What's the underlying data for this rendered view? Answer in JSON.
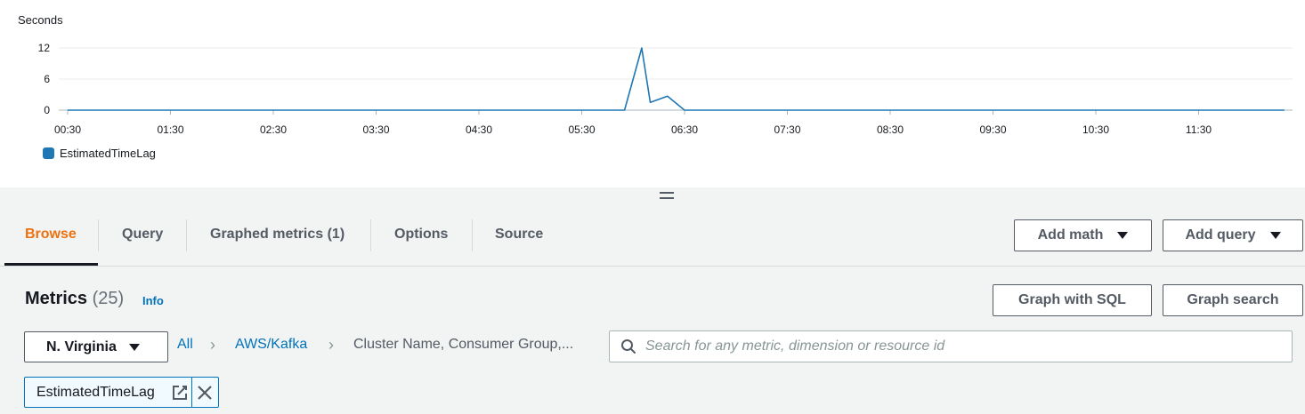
{
  "chart_data": {
    "type": "line",
    "ylabel": "Seconds",
    "y_ticks": [
      "12",
      "6",
      "0"
    ],
    "x_ticks": [
      "00:30",
      "01:30",
      "02:30",
      "03:30",
      "04:30",
      "05:30",
      "06:30",
      "07:30",
      "08:30",
      "09:30",
      "10:30",
      "11:30"
    ],
    "ylim": [
      0,
      12
    ],
    "grid": true,
    "legend_position": "bottom-left",
    "series": [
      {
        "name": "EstimatedTimeLag",
        "color": "#1f77b4",
        "points": [
          {
            "x": "00:30",
            "y": 0
          },
          {
            "x": "05:55",
            "y": 0
          },
          {
            "x": "06:05",
            "y": 12
          },
          {
            "x": "06:10",
            "y": 1.5
          },
          {
            "x": "06:20",
            "y": 2.7
          },
          {
            "x": "06:30",
            "y": 0
          },
          {
            "x": "11:30",
            "y": 0
          },
          {
            "x": "12:20",
            "y": 0
          }
        ]
      }
    ]
  },
  "tabs": [
    {
      "label": "Browse",
      "active": true
    },
    {
      "label": "Query"
    },
    {
      "label": "Graphed metrics (1)"
    },
    {
      "label": "Options"
    },
    {
      "label": "Source"
    }
  ],
  "toolbar": {
    "add_math": "Add math",
    "add_query": "Add query",
    "graph_with_sql": "Graph with SQL",
    "graph_search": "Graph search"
  },
  "metrics": {
    "title": "Metrics",
    "count": "(25)",
    "info": "Info"
  },
  "region": "N. Virginia",
  "breadcrumb": [
    "All",
    "AWS/Kafka",
    "Cluster Name, Consumer Group,..."
  ],
  "search": {
    "placeholder": "Search for any metric, dimension or resource id",
    "value": ""
  },
  "filter_token": "EstimatedTimeLag",
  "colors": {
    "accent": "#ec7211",
    "link": "#0073bb",
    "series": "#1f77b4"
  },
  "icons": [
    "search-icon",
    "edit-icon",
    "close-icon",
    "caret-down-icon",
    "chevron-right-icon",
    "drag-handle-icon"
  ]
}
